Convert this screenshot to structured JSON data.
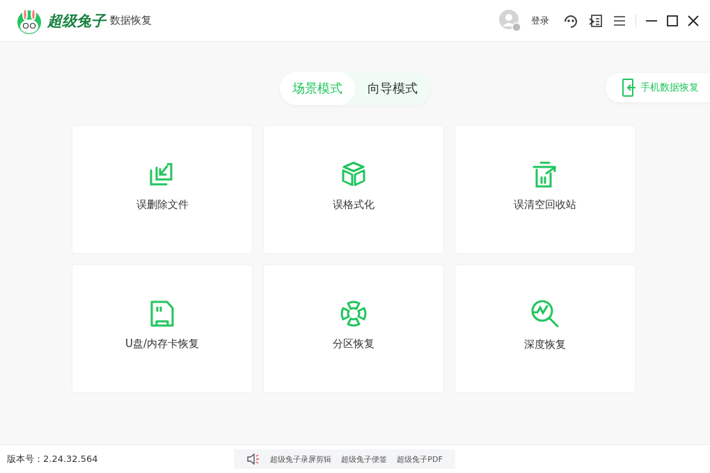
{
  "app": {
    "brand": "超级兔子",
    "product": "数据恢复"
  },
  "header": {
    "login": "登录"
  },
  "modes": [
    {
      "label": "场景模式",
      "selected": true
    },
    {
      "label": "向导模式",
      "selected": false
    }
  ],
  "phone_button": "手机数据恢复",
  "cards": [
    {
      "kind": "deleted",
      "label": "误删除文件"
    },
    {
      "kind": "format",
      "label": "误格式化"
    },
    {
      "kind": "recycle",
      "label": "误清空回收站"
    },
    {
      "kind": "usb",
      "label": "U盘/内存卡恢复"
    },
    {
      "kind": "partition",
      "label": "分区恢复"
    },
    {
      "kind": "deep",
      "label": "深度恢复"
    }
  ],
  "status_bar": {
    "version": "版本号：2.24.32.564",
    "links": [
      "超级兔子录屏剪辑",
      "超级兔子便签",
      "超级兔子PDF"
    ]
  }
}
